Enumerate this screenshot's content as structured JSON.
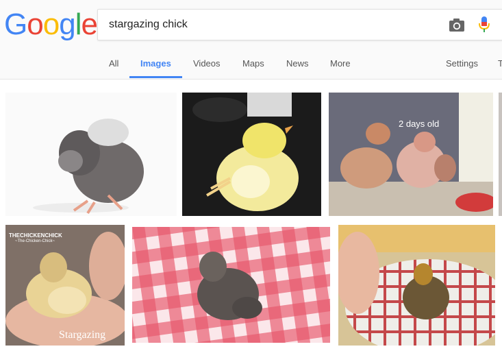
{
  "logo": {
    "letters": [
      "G",
      "o",
      "o",
      "g",
      "l",
      "e"
    ],
    "colors": [
      "#4285f4",
      "#ea4335",
      "#fbbc05",
      "#4285f4",
      "#34a853",
      "#ea4335"
    ]
  },
  "search": {
    "query": "stargazing chick"
  },
  "icons": {
    "camera": "camera-icon",
    "mic": "mic-icon"
  },
  "tabs": {
    "all": "All",
    "images": "Images",
    "videos": "Videos",
    "maps": "Maps",
    "news": "News",
    "more": "More",
    "settings": "Settings",
    "tools": "T"
  },
  "results": {
    "r2_caption": "2 days old",
    "r4_watermark": "THECHICKENCHICK",
    "r4_watermark_sub": "~The-Chicken-Chick~",
    "r4_caption": "Stargazing"
  },
  "colors": {
    "accent": "#4285f4"
  }
}
